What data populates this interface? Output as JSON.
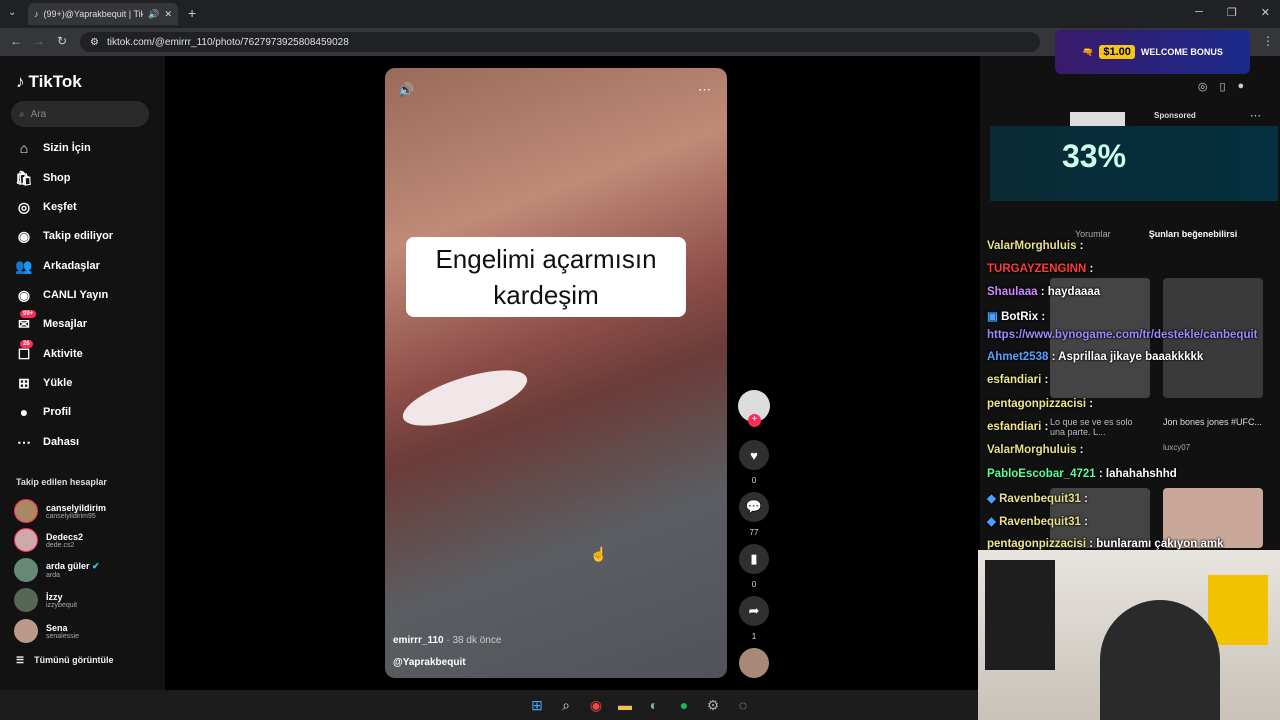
{
  "browser": {
    "tab_title": "(99+)@Yaprakbequit | TikTo",
    "url": "tiktok.com/@emirrr_110/photo/7627973925808459028"
  },
  "sidebar": {
    "logo": "TikTok",
    "search_placeholder": "Ara",
    "items": [
      {
        "label": "Sizin İçin",
        "icon": "home-icon"
      },
      {
        "label": "Shop",
        "icon": "shop-icon"
      },
      {
        "label": "Keşfet",
        "icon": "compass-icon"
      },
      {
        "label": "Takip ediliyor",
        "icon": "following-icon"
      },
      {
        "label": "Arkadaşlar",
        "icon": "friends-icon"
      },
      {
        "label": "CANLI Yayın",
        "icon": "live-icon"
      },
      {
        "label": "Mesajlar",
        "icon": "messages-icon",
        "badge": "99+"
      },
      {
        "label": "Aktivite",
        "icon": "activity-icon",
        "badge": "26"
      },
      {
        "label": "Yükle",
        "icon": "upload-icon"
      },
      {
        "label": "Profil",
        "icon": "profile-icon"
      },
      {
        "label": "Dahası",
        "icon": "more-icon"
      }
    ],
    "following_heading": "Takip edilen hesaplar",
    "following": [
      {
        "name": "canselyildirim",
        "handle": "canselyildirim95"
      },
      {
        "name": "Dedecs2",
        "handle": "dede.cs2"
      },
      {
        "name": "arda güler",
        "handle": "arda"
      },
      {
        "name": "İzzy",
        "handle": "izzybequit"
      },
      {
        "name": "Sena",
        "handle": "senalessie"
      }
    ],
    "see_all": "Tümünü görüntüle"
  },
  "video": {
    "caption_line1": "Engelimi açarmısın",
    "caption_line2": "kardeşim",
    "author": "emirrr_110",
    "time": "· 38 dk önce",
    "mention": "@Yaprakbequit",
    "likes": "0",
    "comments": "77",
    "saves": "0",
    "shares": "1"
  },
  "right": {
    "ad_amount": "$1.00",
    "ad_text": "WELCOME BONUS",
    "sponsored": "Sponsored",
    "promo": "33%",
    "tab_comments": "Yorumlar",
    "tab_suggest": "Şunları beğenebilirsi",
    "thumb1_title": "Lo que se ve es solo una parte. L...",
    "thumb2_title": "Jon bones jones #UFC...",
    "thumb2_user": "luxcy07"
  },
  "chat": [
    {
      "user": "ValarMorghuluis",
      "msg": "",
      "color": "#e8e08a"
    },
    {
      "user": "TURGAYZENGINN",
      "msg": "",
      "color": "#ff3b3b"
    },
    {
      "user": "Shaulaaa",
      "msg": "haydaaaa",
      "color": "#d08aff"
    },
    {
      "user": "BotRix",
      "msg": "",
      "color": "#ffffff"
    },
    {
      "user": "",
      "msg": "https://www.bynogame.com/tr/destekle/canbequit",
      "color": "#9a8cff"
    },
    {
      "user": "Ahmet2538",
      "msg": "Asprillaa jikaye baaakkkkk",
      "color": "#5aa0ff"
    },
    {
      "user": "esfandiari",
      "msg": "",
      "color": "#f0e68c"
    },
    {
      "user": "pentagonpizzacisi",
      "msg": "",
      "color": "#f0e68c"
    },
    {
      "user": "esfandiari",
      "msg": "",
      "color": "#f0e68c"
    },
    {
      "user": "ValarMorghuluis",
      "msg": "",
      "color": "#e8e08a"
    },
    {
      "user": "PabloEscobar_4721",
      "msg": "lahahahshhd",
      "color": "#5aff9a"
    },
    {
      "user": "Ravenbequit31",
      "msg": "",
      "color": "#e8e08a"
    },
    {
      "user": "Ravenbequit31",
      "msg": "",
      "color": "#e8e08a"
    },
    {
      "user": "pentagonpizzacisi",
      "msg": "bunlaramı çakıyon amk",
      "color": "#f0e68c"
    }
  ]
}
